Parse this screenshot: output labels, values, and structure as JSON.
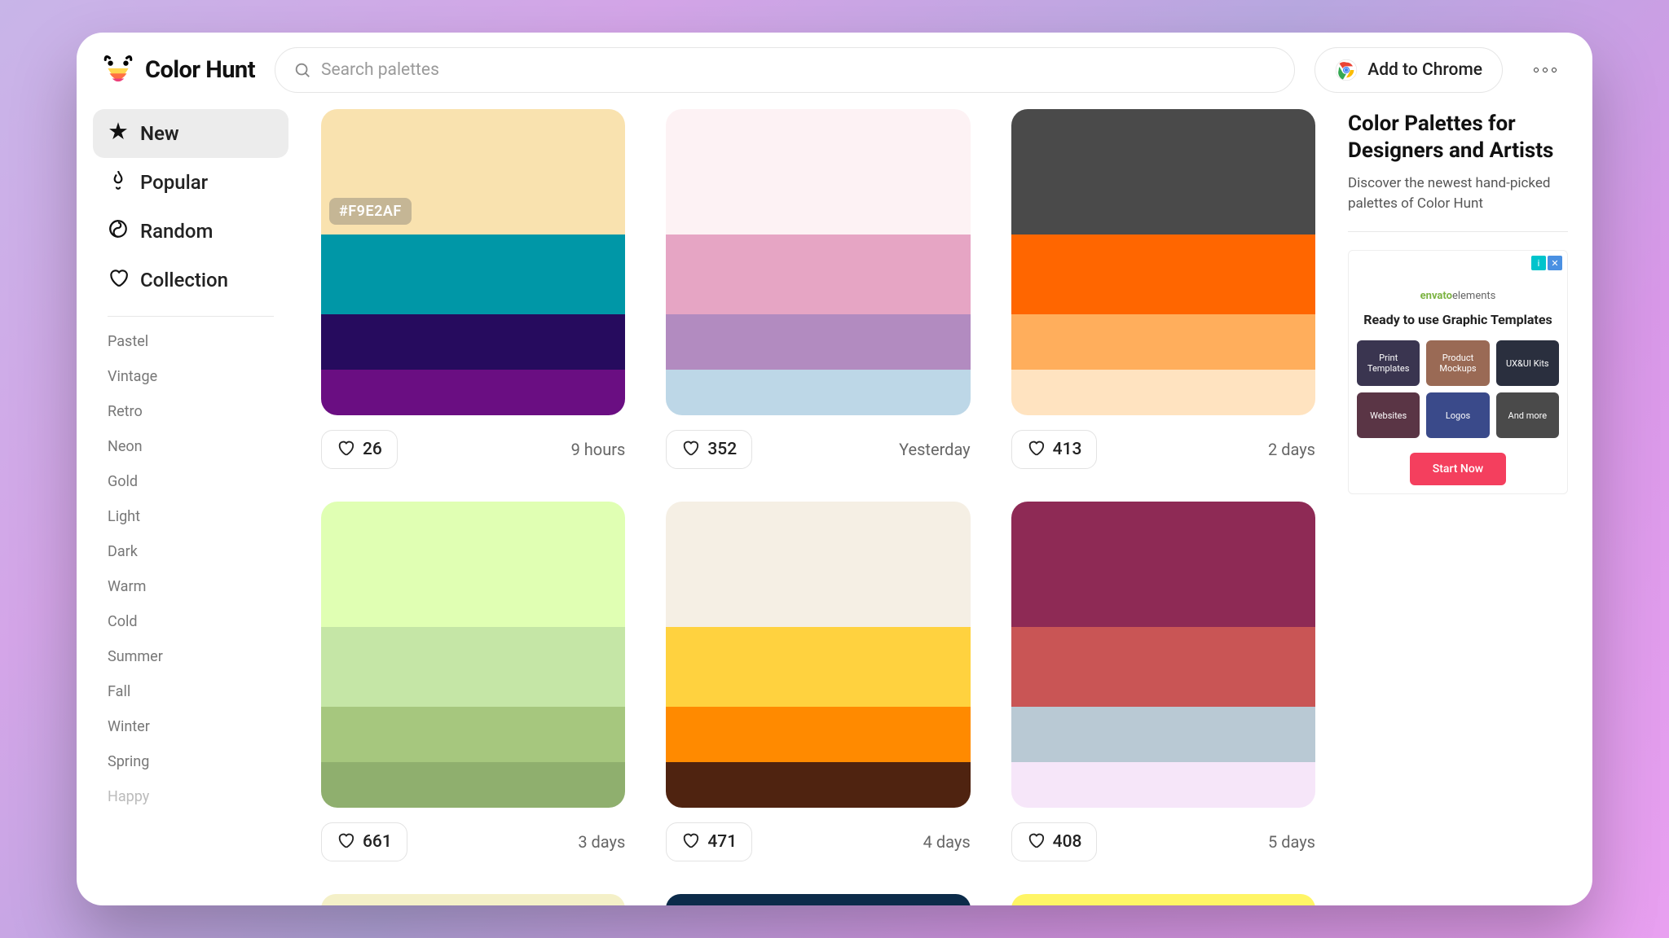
{
  "brand": {
    "name": "Color Hunt"
  },
  "search": {
    "placeholder": "Search palettes"
  },
  "header": {
    "chrome_label": "Add to Chrome"
  },
  "nav": {
    "items": [
      {
        "label": "New",
        "active": true
      },
      {
        "label": "Popular",
        "active": false
      },
      {
        "label": "Random",
        "active": false
      },
      {
        "label": "Collection",
        "active": false
      }
    ]
  },
  "tags": [
    "Pastel",
    "Vintage",
    "Retro",
    "Neon",
    "Gold",
    "Light",
    "Dark",
    "Warm",
    "Cold",
    "Summer",
    "Fall",
    "Winter",
    "Spring",
    "Happy"
  ],
  "palettes": [
    {
      "colors": [
        "#F9E2AF",
        "#0097A7",
        "#260B5E",
        "#6A0E82"
      ],
      "hex_shown": "#F9E2AF",
      "likes": "26",
      "time": "9 hours"
    },
    {
      "colors": [
        "#FDF2F4",
        "#E6A5C4",
        "#B28BC0",
        "#BDD7E7"
      ],
      "hex_shown": null,
      "likes": "352",
      "time": "Yesterday"
    },
    {
      "colors": [
        "#4A4A4A",
        "#FF6600",
        "#FFAE5C",
        "#FFE3C0"
      ],
      "hex_shown": null,
      "likes": "413",
      "time": "2 days"
    },
    {
      "colors": [
        "#E0FFB3",
        "#C5E6A6",
        "#A6C77E",
        "#8FAF6E"
      ],
      "hex_shown": null,
      "likes": "661",
      "time": "3 days"
    },
    {
      "colors": [
        "#F5EFE4",
        "#FFD23F",
        "#FF8A00",
        "#4F2310"
      ],
      "hex_shown": null,
      "likes": "471",
      "time": "4 days"
    },
    {
      "colors": [
        "#8E2A55",
        "#C95555",
        "#B9C9D4",
        "#F6E6F9"
      ],
      "hex_shown": null,
      "likes": "408",
      "time": "5 days"
    }
  ],
  "bottom_row_colors": [
    "#F4F0C8",
    "#0C2B4A",
    "#FFF566"
  ],
  "right": {
    "title": "Color Palettes for Designers and Artists",
    "subtitle": "Discover the newest hand-picked palettes of Color Hunt"
  },
  "ad": {
    "logo_prefix": "envato",
    "logo_suffix": "elements",
    "headline": "Ready to use Graphic Templates",
    "tiles": [
      {
        "label": "Print Templates",
        "bg": "#3a3550"
      },
      {
        "label": "Product Mockups",
        "bg": "#9a6a55"
      },
      {
        "label": "UX&UI Kits",
        "bg": "#2a2f3e"
      },
      {
        "label": "Websites",
        "bg": "#5a3545"
      },
      {
        "label": "Logos",
        "bg": "#3a4a8a"
      },
      {
        "label": "And more",
        "bg": "#4a4a4a"
      }
    ],
    "cta": "Start Now"
  }
}
